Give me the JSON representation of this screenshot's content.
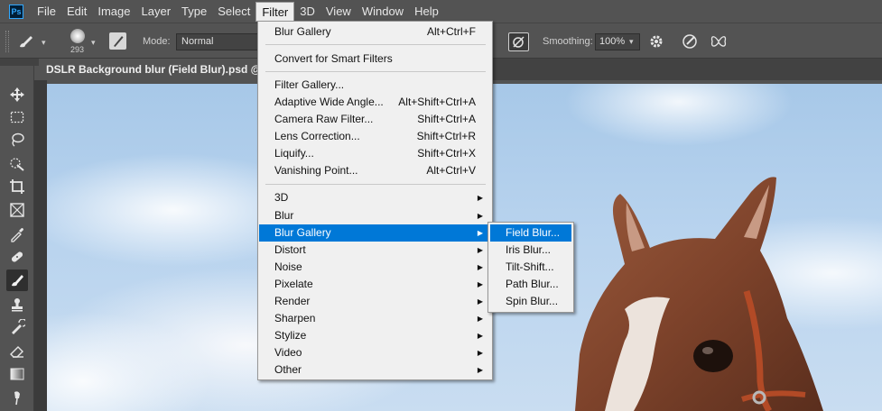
{
  "app": {
    "logo": "Ps"
  },
  "menubar": {
    "items": [
      "File",
      "Edit",
      "Image",
      "Layer",
      "Type",
      "Select",
      "Filter",
      "3D",
      "View",
      "Window",
      "Help"
    ],
    "active_index": 6
  },
  "options": {
    "brush_size": "293",
    "mode_label": "Mode:",
    "mode_value": "Normal",
    "smoothing_label": "Smoothing:",
    "smoothing_value": "100%"
  },
  "document": {
    "tab_title": "DSLR Background blur (Field Blur).psd @ 67.",
    "tab_close": "×"
  },
  "filter_menu": {
    "items": [
      {
        "label": "Blur Gallery",
        "shortcut": "Alt+Ctrl+F"
      },
      {
        "label": "Convert for Smart Filters",
        "shortcut": ""
      },
      {
        "label": "Filter Gallery...",
        "shortcut": ""
      },
      {
        "label": "Adaptive Wide Angle...",
        "shortcut": "Alt+Shift+Ctrl+A"
      },
      {
        "label": "Camera Raw Filter...",
        "shortcut": "Shift+Ctrl+A"
      },
      {
        "label": "Lens Correction...",
        "shortcut": "Shift+Ctrl+R"
      },
      {
        "label": "Liquify...",
        "shortcut": "Shift+Ctrl+X"
      },
      {
        "label": "Vanishing Point...",
        "shortcut": "Alt+Ctrl+V"
      },
      {
        "label": "3D",
        "submenu": true
      },
      {
        "label": "Blur",
        "submenu": true
      },
      {
        "label": "Blur Gallery",
        "submenu": true,
        "highlighted": true
      },
      {
        "label": "Distort",
        "submenu": true
      },
      {
        "label": "Noise",
        "submenu": true
      },
      {
        "label": "Pixelate",
        "submenu": true
      },
      {
        "label": "Render",
        "submenu": true
      },
      {
        "label": "Sharpen",
        "submenu": true
      },
      {
        "label": "Stylize",
        "submenu": true
      },
      {
        "label": "Video",
        "submenu": true
      },
      {
        "label": "Other",
        "submenu": true
      }
    ],
    "submenu_arrow": "▶"
  },
  "blur_gallery_submenu": {
    "items": [
      "Field Blur...",
      "Iris Blur...",
      "Tilt-Shift...",
      "Path Blur...",
      "Spin Blur..."
    ],
    "highlighted_index": 0
  },
  "tools": [
    "move-icon",
    "marquee-icon",
    "lasso-icon",
    "quick-select-icon",
    "crop-icon",
    "frame-icon",
    "eyedropper-icon",
    "healing-icon",
    "brush-icon",
    "stamp-icon",
    "history-brush-icon",
    "eraser-icon",
    "gradient-icon",
    "smudge-icon"
  ],
  "colors": {
    "accent": "#0078d7",
    "ps_blue": "#31a8ff",
    "ui_dark": "#535353"
  }
}
